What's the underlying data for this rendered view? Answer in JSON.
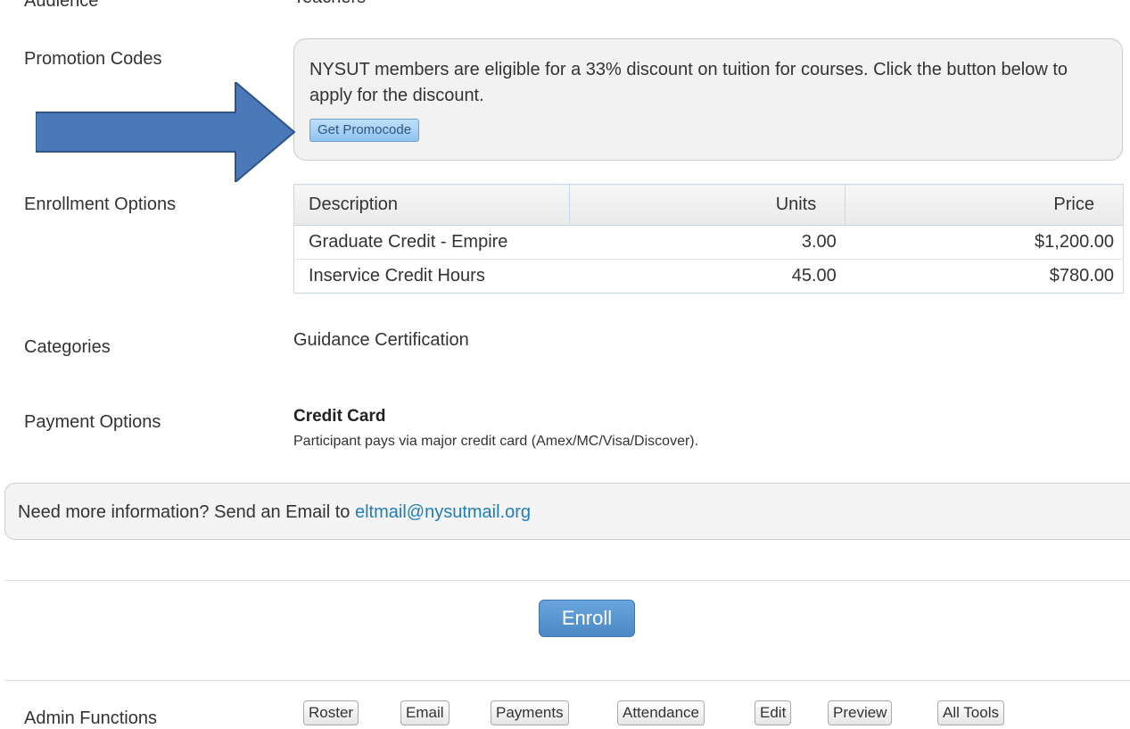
{
  "audience": {
    "label": "Audience",
    "value": "Teachers"
  },
  "promotion_codes": {
    "label": "Promotion Codes",
    "text": "NYSUT members are eligible for a 33% discount on tuition for courses. Click the button below to apply for the discount.",
    "button_label": "Get Promocode"
  },
  "enrollment_options": {
    "label": "Enrollment Options",
    "columns": [
      "Description",
      "Units",
      "Price"
    ],
    "rows": [
      [
        "Graduate Credit - Empire",
        "3.00",
        "$1,200.00"
      ],
      [
        "Inservice Credit Hours",
        "45.00",
        "$780.00"
      ]
    ]
  },
  "categories": {
    "label": "Categories",
    "value": "Guidance Certification"
  },
  "payment_options": {
    "label": "Payment Options",
    "title": "Credit Card",
    "description": "Participant pays via major credit card (Amex/MC/Visa/Discover)."
  },
  "info_bar": {
    "text": "Need more information? Send an Email to",
    "link": "eltmail@nysutmail.org"
  },
  "enroll_button": "Enroll",
  "admin": {
    "label": "Admin Functions",
    "tools": [
      "Roster",
      "Email",
      "Payments",
      "Attendance",
      "Edit",
      "Preview",
      "All Tools"
    ]
  },
  "colors": {
    "arrow_fill": "#4a78b8",
    "arrow_stroke": "#2f5488",
    "link": "#1f7dbf",
    "enroll_button": "#5597d3"
  }
}
